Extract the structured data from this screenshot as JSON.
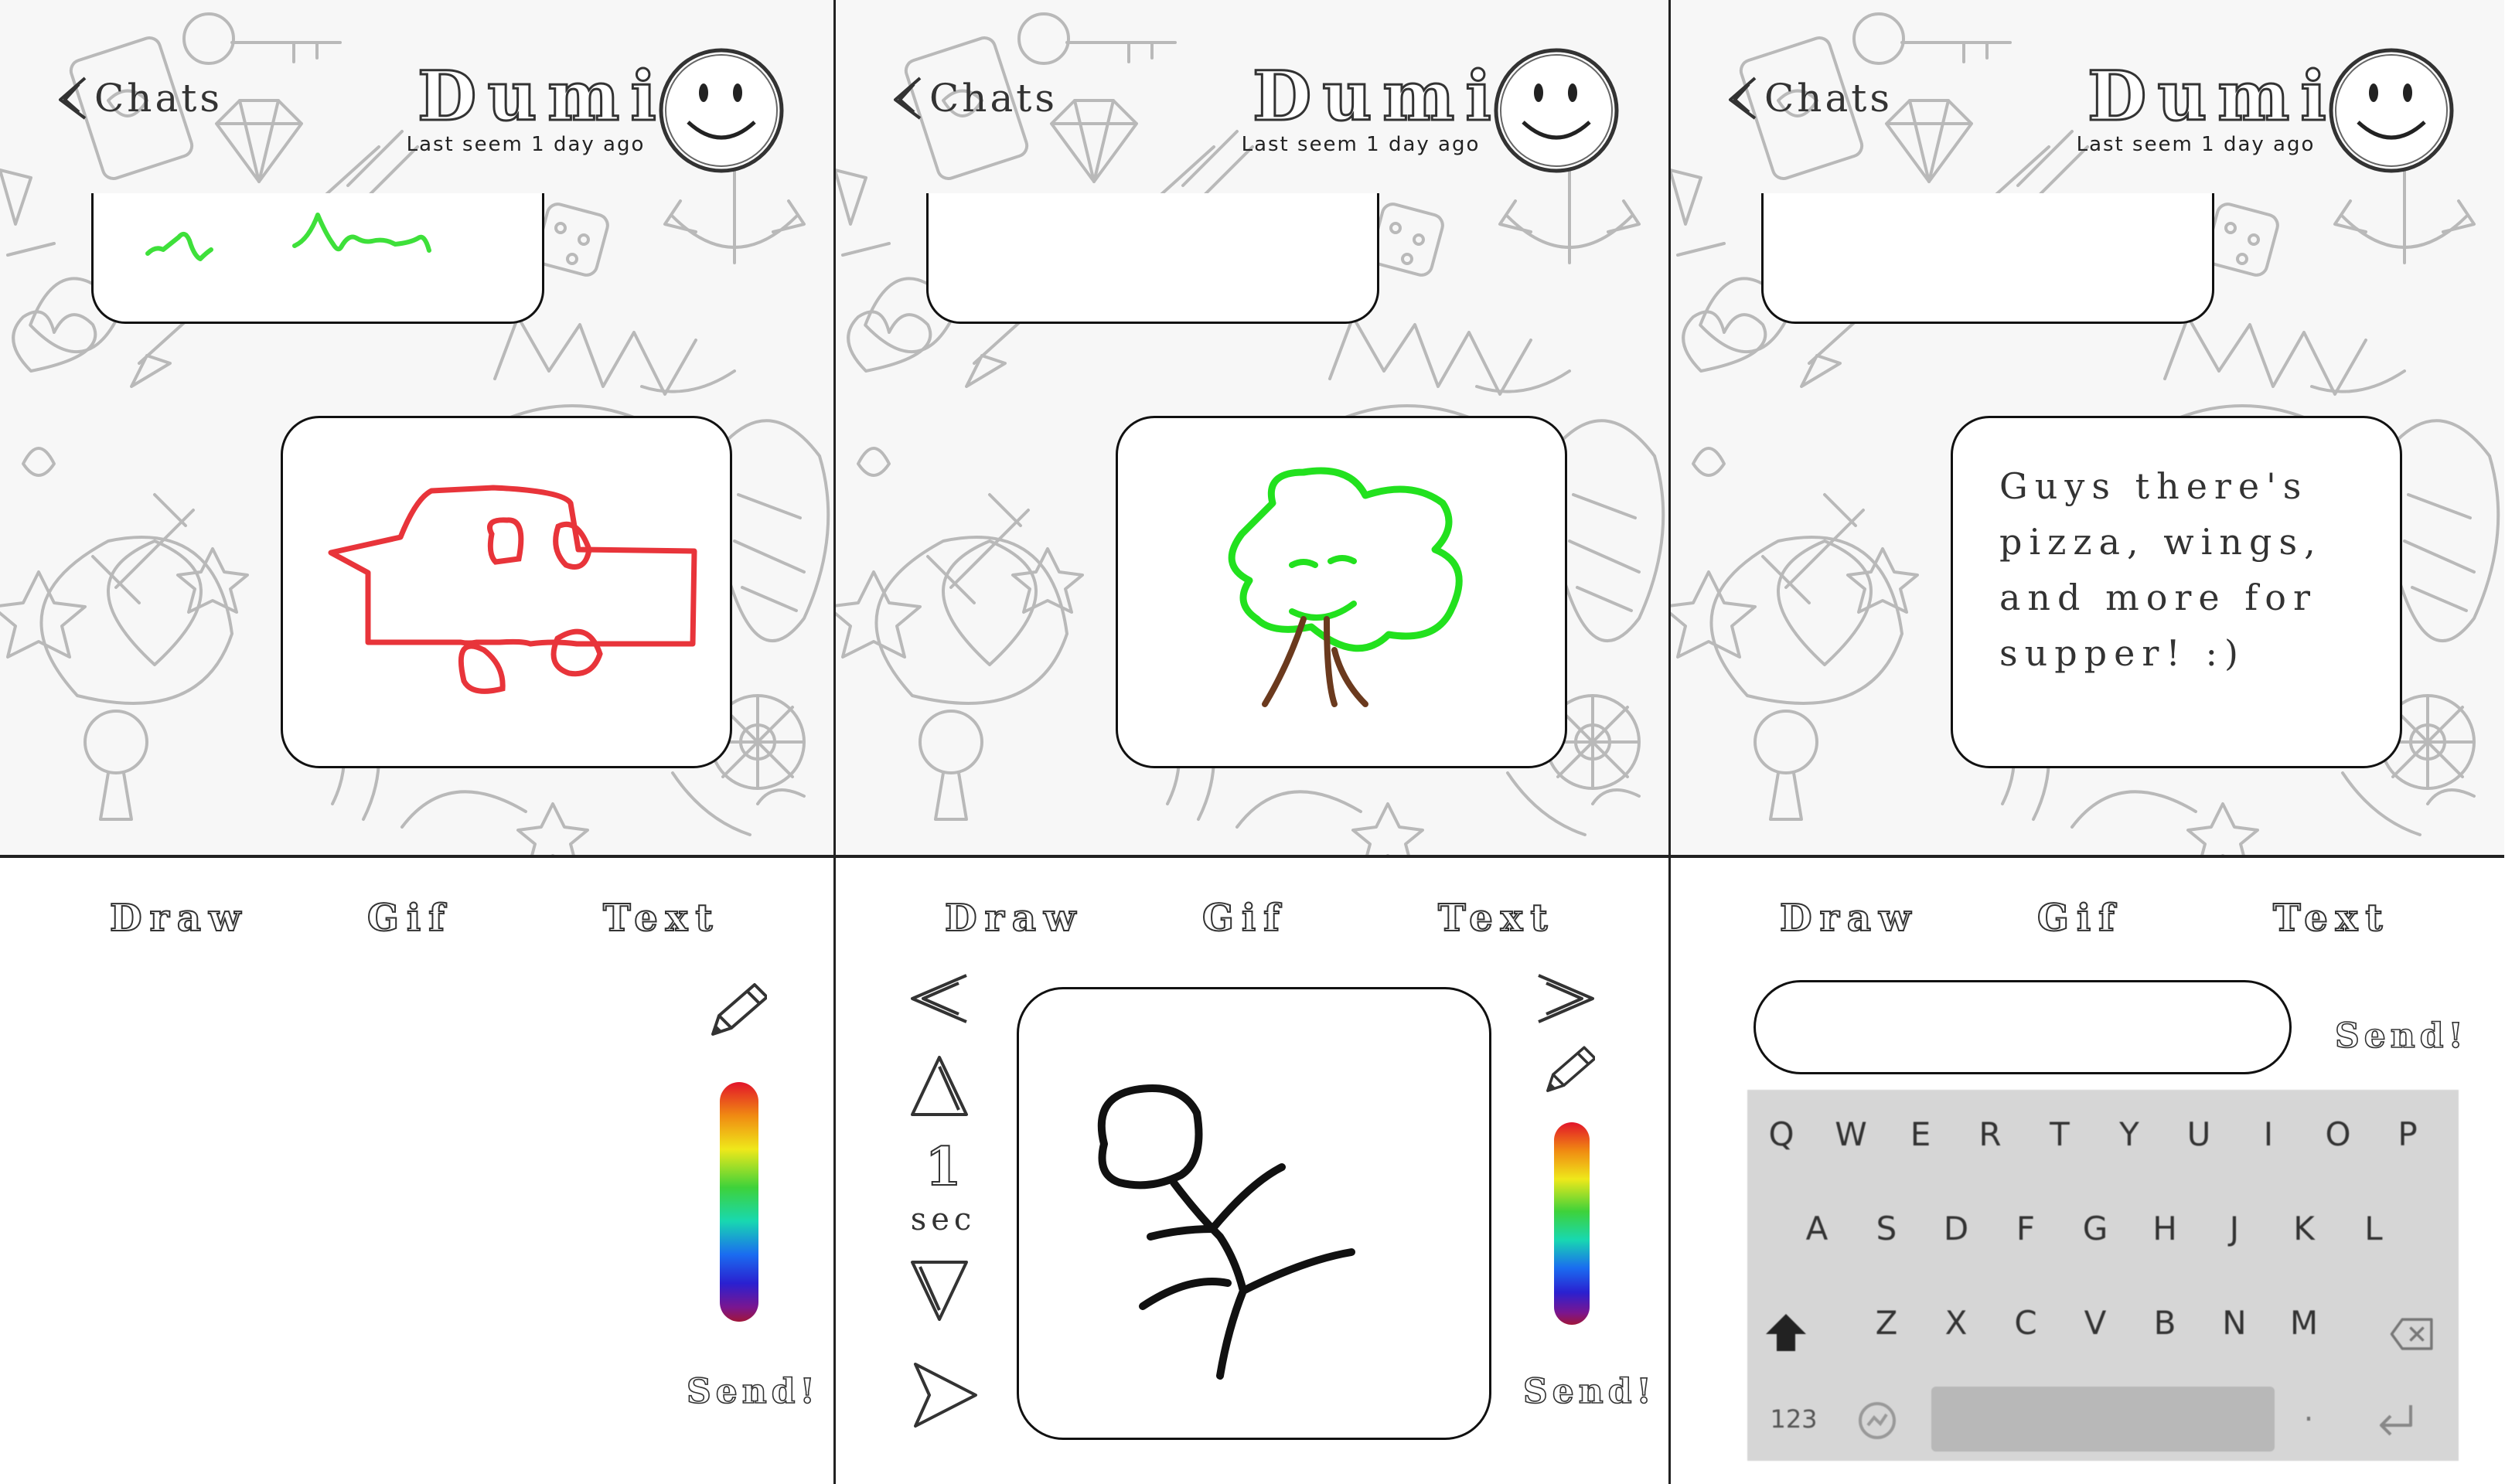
{
  "header": {
    "back_label": "Chats",
    "contact_name": "Dumi",
    "status": "Last seem 1 day ago"
  },
  "tabs": [
    "Draw",
    "Gif",
    "Text"
  ],
  "send_label": "Send!",
  "timer": {
    "value": "1",
    "unit": "sec"
  },
  "message_text": "Guys there's\npizza, wings,\nand more for\nsupper! :)",
  "keyboard": {
    "row1": [
      "Q",
      "W",
      "E",
      "R",
      "T",
      "Y",
      "U",
      "I",
      "O",
      "P"
    ],
    "row2": [
      "A",
      "S",
      "D",
      "F",
      "G",
      "H",
      "J",
      "K",
      "L"
    ],
    "row3": [
      "Z",
      "X",
      "C",
      "V",
      "B",
      "N",
      "M"
    ],
    "numbers_key": "123"
  },
  "colors": {
    "car_drawing": "#e8343a",
    "tree_leaves": "#22e11e",
    "tree_trunk": "#6b3a1e",
    "stick_figure": "#111111",
    "wave_drawing": "#3ee03a"
  },
  "icons": [
    "chevron-left-icon",
    "smiley-avatar-icon",
    "pencil-icon",
    "arrow-left-icon",
    "arrow-right-icon",
    "triangle-up-icon",
    "triangle-down-icon",
    "play-icon",
    "shift-icon",
    "backspace-icon",
    "emoji-icon",
    "return-icon"
  ]
}
